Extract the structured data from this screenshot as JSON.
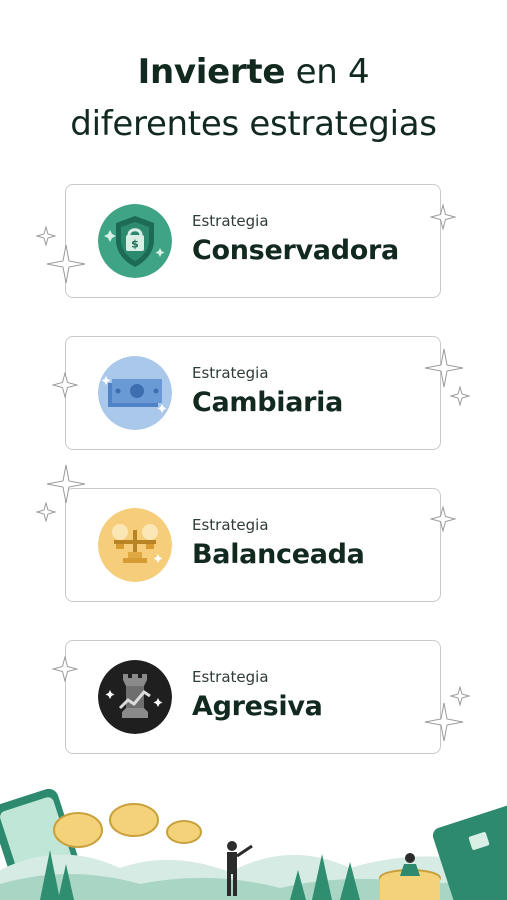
{
  "header": {
    "title_bold": "Invierte",
    "title_rest": " en 4",
    "title_line2": "diferentes estrategias"
  },
  "strategies": [
    {
      "label": "Estrategia",
      "name": "Conservadora",
      "icon": "shield-dollar-icon",
      "color": "#3fa386"
    },
    {
      "label": "Estrategia",
      "name": "Cambiaria",
      "icon": "banknote-icon",
      "color": "#a9c8ea"
    },
    {
      "label": "Estrategia",
      "name": "Balanceada",
      "icon": "balance-scale-icon",
      "color": "#f6cd7a"
    },
    {
      "label": "Estrategia",
      "name": "Agresiva",
      "icon": "chess-rook-icon",
      "color": "#1f1f1f"
    }
  ]
}
